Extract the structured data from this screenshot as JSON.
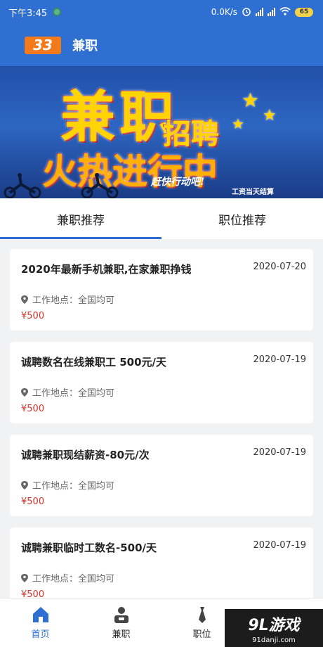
{
  "status_bar": {
    "time": "下午3:45",
    "speed": "0.0K/s",
    "battery": "65"
  },
  "app_bar": {
    "logo_text": "33",
    "title": "兼职"
  },
  "banner": {
    "line1": "兼职",
    "line2": "招聘",
    "line3": "火热进行中",
    "line4": "赶快行动吧!",
    "line5": "工资当天结算"
  },
  "tabs": [
    {
      "label": "兼职推荐"
    },
    {
      "label": "职位推荐"
    }
  ],
  "jobs": [
    {
      "title": "2020年最新手机兼职,在家兼职挣钱",
      "date": "2020-07-20",
      "location": "工作地点：全国均可",
      "salary": "¥500"
    },
    {
      "title": "诚聘数名在线兼职工 500元/天",
      "date": "2020-07-19",
      "location": "工作地点：全国均可",
      "salary": "¥500"
    },
    {
      "title": "诚聘兼职现结薪资-80元/次",
      "date": "2020-07-19",
      "location": "工作地点：全国均可",
      "salary": "¥500"
    },
    {
      "title": "诚聘兼职临时工数名-500/天",
      "date": "2020-07-19",
      "location": "工作地点：全国均可",
      "salary": "¥500"
    }
  ],
  "bottom_nav": [
    {
      "label": "首页",
      "icon": "home-icon"
    },
    {
      "label": "兼职",
      "icon": "person-icon"
    },
    {
      "label": "职位",
      "icon": "tie-icon"
    },
    {
      "label": "",
      "icon": "user-icon"
    }
  ],
  "watermark": {
    "main": "9L游戏",
    "url": "91danji.com"
  },
  "colors": {
    "primary": "#2f6fd1",
    "salary": "#d6332c",
    "logo": "#f27a1a"
  }
}
